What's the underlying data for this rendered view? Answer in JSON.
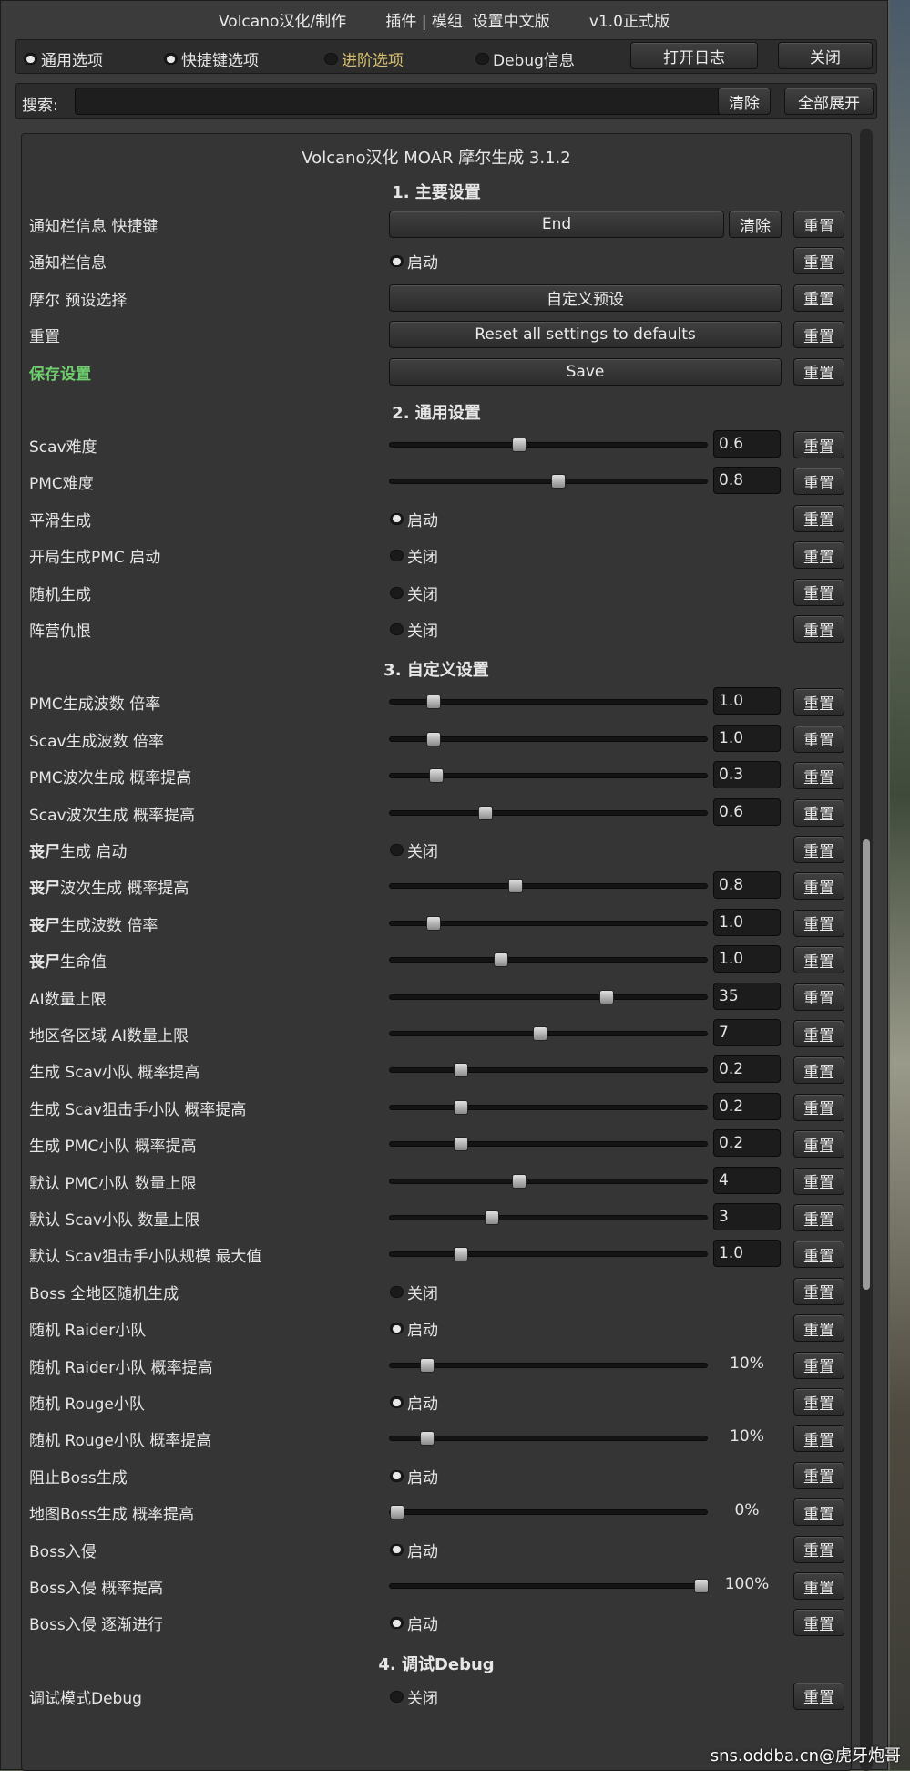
{
  "window": {
    "title": "Volcano汉化/制作        插件 | 模组  设置中文版        v1.0正式版"
  },
  "toolbar": {
    "options": [
      {
        "label": "通用选项",
        "selected": true
      },
      {
        "label": "快捷键选项",
        "selected": true
      },
      {
        "label": "进阶选项",
        "selected": false
      },
      {
        "label": "Debug信息",
        "selected": false
      }
    ],
    "open_log": "打开日志",
    "close": "关闭"
  },
  "search": {
    "label": "搜索:",
    "value": "",
    "clear": "清除",
    "expand_all": "全部展开"
  },
  "panel": {
    "title": "Volcano汉化 MOAR 摩尔生成 3.1.2",
    "reset_label": "重置",
    "on_label": "启动",
    "off_label": "关闭",
    "sections": [
      {
        "header": "1. 主要设置",
        "rows": [
          {
            "label": "通知栏信息 快捷键",
            "type": "key",
            "value": "End",
            "clear": "清除"
          },
          {
            "label": "通知栏信息",
            "type": "toggle",
            "on": true
          },
          {
            "label": "摩尔 预设选择",
            "type": "button",
            "value": "自定义预设"
          },
          {
            "label": "重置",
            "type": "button",
            "value": "Reset all settings to defaults"
          },
          {
            "label": "保存设置",
            "type": "button",
            "value": "Save",
            "green": true
          }
        ]
      },
      {
        "header": "2. 通用设置",
        "rows": [
          {
            "label": "Scav难度",
            "type": "slider",
            "pos": 0.4,
            "value": "0.6"
          },
          {
            "label": "PMC难度",
            "type": "slider",
            "pos": 0.53,
            "value": "0.8"
          },
          {
            "label": "平滑生成",
            "type": "toggle",
            "on": true
          },
          {
            "label": "开局生成PMC 启动",
            "type": "toggle",
            "on": false
          },
          {
            "label": "随机生成",
            "type": "toggle",
            "on": false
          },
          {
            "label": "阵营仇恨",
            "type": "toggle",
            "on": false
          }
        ]
      },
      {
        "header": "3. 自定义设置",
        "rows": [
          {
            "label": "PMC生成波数 倍率",
            "type": "slider",
            "pos": 0.12,
            "value": "1.0"
          },
          {
            "label": "Scav生成波数 倍率",
            "type": "slider",
            "pos": 0.12,
            "value": "1.0"
          },
          {
            "label": "PMC波次生成 概率提高",
            "type": "slider",
            "pos": 0.13,
            "value": "0.3"
          },
          {
            "label": "Scav波次生成 概率提高",
            "type": "slider",
            "pos": 0.29,
            "value": "0.6"
          },
          {
            "label": "丧尸生成 启动",
            "type": "toggle",
            "on": false,
            "bold_prefix": "丧尸",
            "suffix": "生成 启动"
          },
          {
            "label": "丧尸波次生成 概率提高",
            "type": "slider",
            "pos": 0.39,
            "value": "0.8",
            "bold_prefix": "丧尸",
            "suffix": "波次生成 概率提高"
          },
          {
            "label": "丧尸生成波数 倍率",
            "type": "slider",
            "pos": 0.12,
            "value": "1.0",
            "bold_prefix": "丧尸",
            "suffix": "生成波数 倍率"
          },
          {
            "label": "丧尸生命值",
            "type": "slider",
            "pos": 0.34,
            "value": "1.0",
            "bold_prefix": "丧尸",
            "suffix": "生命值"
          },
          {
            "label": "AI数量上限",
            "type": "slider",
            "pos": 0.69,
            "value": "35"
          },
          {
            "label": "地区各区域 AI数量上限",
            "type": "slider",
            "pos": 0.47,
            "value": "7"
          },
          {
            "label": "生成 Scav小队 概率提高",
            "type": "slider",
            "pos": 0.21,
            "value": "0.2"
          },
          {
            "label": "生成 Scav狙击手小队 概率提高",
            "type": "slider",
            "pos": 0.21,
            "value": "0.2"
          },
          {
            "label": "生成 PMC小队 概率提高",
            "type": "slider",
            "pos": 0.21,
            "value": "0.2"
          },
          {
            "label": "默认 PMC小队 数量上限",
            "type": "slider",
            "pos": 0.4,
            "value": "4"
          },
          {
            "label": "默认 Scav小队 数量上限",
            "type": "slider",
            "pos": 0.31,
            "value": "3"
          },
          {
            "label": "默认 Scav狙击手小队规模 最大值",
            "type": "slider",
            "pos": 0.21,
            "value": "1.0"
          },
          {
            "label": "Boss 全地区随机生成",
            "type": "toggle",
            "on": false
          },
          {
            "label": "随机 Raider小队",
            "type": "toggle",
            "on": true
          },
          {
            "label": "随机 Raider小队 概率提高",
            "type": "percent",
            "pos": 0.1,
            "value": "10%"
          },
          {
            "label": "随机 Rouge小队",
            "type": "toggle",
            "on": true
          },
          {
            "label": "随机 Rouge小队 概率提高",
            "type": "percent",
            "pos": 0.1,
            "value": "10%"
          },
          {
            "label": "阻止Boss生成",
            "type": "toggle",
            "on": true
          },
          {
            "label": "地图Boss生成 概率提高",
            "type": "percent",
            "pos": 0.0,
            "value": "0%"
          },
          {
            "label": "Boss入侵",
            "type": "toggle",
            "on": true
          },
          {
            "label": "Boss入侵 概率提高",
            "type": "percent",
            "pos": 1.0,
            "value": "100%"
          },
          {
            "label": "Boss入侵 逐渐进行",
            "type": "toggle",
            "on": true
          }
        ]
      },
      {
        "header": "4. 调试Debug",
        "rows": [
          {
            "label": "调试模式Debug",
            "type": "toggle",
            "on": false
          }
        ]
      }
    ]
  },
  "watermark": "sns.oddba.cn@虎牙炮哥"
}
